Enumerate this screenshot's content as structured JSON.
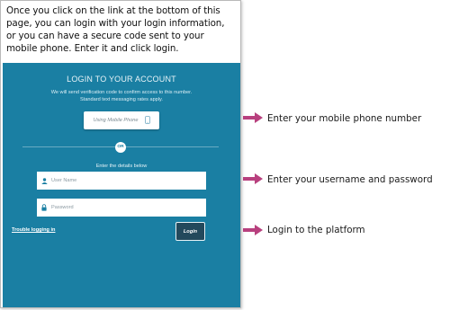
{
  "intro": {
    "lines": [
      "Once you click on the link at the bottom of this",
      "page, you can login with your login information,",
      "or you can have a secure code sent to your",
      "mobile phone. Enter it and click login."
    ]
  },
  "panel": {
    "title": "LOGIN TO YOUR ACCOUNT",
    "note_line1": "We will send verification code to confirm access to this number.",
    "note_line2": "Standard text messaging rates apply.",
    "mobile_button_label": "Using Mobile Phone",
    "or_label": "OR",
    "details_label": "Enter the details below",
    "username_placeholder": "User Name",
    "password_placeholder": "Password",
    "trouble_link": "Trouble logging in",
    "login_button": "Login",
    "bg_color": "#1a7fa3"
  },
  "callouts": [
    {
      "text": "Enter your mobile phone number",
      "icon": "arrow-right-icon"
    },
    {
      "text": "Enter your username and password",
      "icon": "arrow-right-icon"
    },
    {
      "text": "Login to the platform",
      "icon": "arrow-right-icon"
    }
  ],
  "colors": {
    "arrow": "#b8407e",
    "accent": "#1a7fa3"
  }
}
